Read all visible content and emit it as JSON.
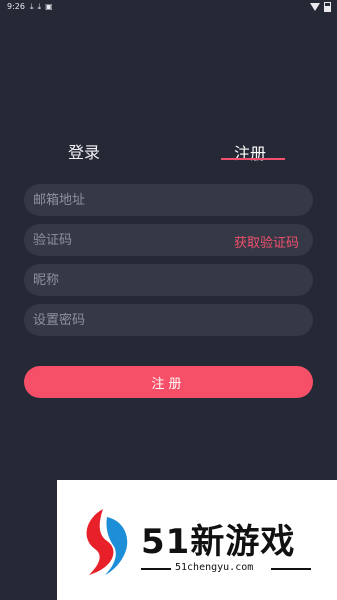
{
  "status_bar": {
    "time": "9:26",
    "icons_left": [
      "download-icon",
      "download-icon",
      "app-notification-icon"
    ],
    "icons_right": [
      "wifi-icon",
      "battery-icon"
    ]
  },
  "tabs": {
    "login_label": "登录",
    "register_label": "注册",
    "active": "register",
    "accent_color": "#f0506e"
  },
  "form": {
    "email_placeholder": "邮箱地址",
    "code_placeholder": "验证码",
    "get_code_label": "获取验证码",
    "nickname_placeholder": "昵称",
    "password_placeholder": "设置密码",
    "submit_label": "注册"
  },
  "watermark": {
    "title": "51新游戏",
    "url": "51chengyu.com"
  },
  "colors": {
    "background": "#252835",
    "field": "#353845",
    "button": "#f55068"
  }
}
